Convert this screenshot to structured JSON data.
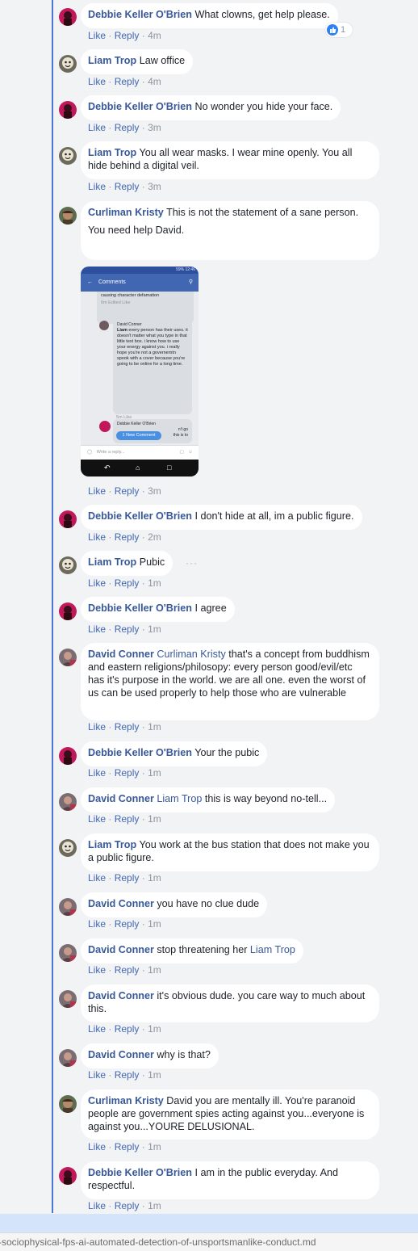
{
  "comments": [
    {
      "author": "Debbie Keller O'Brien",
      "text": "What clowns, get help please.",
      "like": "Like",
      "reply": "Reply",
      "time": "4m",
      "reactions": "1"
    },
    {
      "author": "Liam Trop",
      "text": "Law office",
      "like": "Like",
      "reply": "Reply",
      "time": "4m"
    },
    {
      "author": "Debbie Keller O'Brien",
      "text": "No wonder you hide your face.",
      "like": "Like",
      "reply": "Reply",
      "time": "3m"
    },
    {
      "author": "Liam Trop",
      "text": "You all wear masks. I wear mine openly. You all hide behind a digital veil.",
      "like": "Like",
      "reply": "Reply",
      "time": "3m"
    },
    {
      "author": "Curliman Kristy",
      "text": "This is not the statement of a sane person.",
      "text2": "You need help David.",
      "like": "Like",
      "reply": "Reply",
      "time": "3m"
    },
    {
      "author": "Debbie Keller O'Brien",
      "text": "I don't hide at all, im a public figure.",
      "like": "Like",
      "reply": "Reply",
      "time": "2m"
    },
    {
      "author": "Liam Trop",
      "text": "Pubic",
      "like": "Like",
      "reply": "Reply",
      "time": "1m"
    },
    {
      "author": "Debbie Keller O'Brien",
      "text": "I agree",
      "like": "Like",
      "reply": "Reply",
      "time": "1m"
    },
    {
      "author": "David Conner",
      "mention": "Curliman Kristy",
      "text": "that's a concept from buddhism and eastern religions/philosopy: every person good/evil/etc has it's purpose in the world. we are all one. even the worst of us can be used properly to help those who are vulnerable",
      "like": "Like",
      "reply": "Reply",
      "time": "1m"
    },
    {
      "author": "Debbie Keller O'Brien",
      "text": "Your the pubic",
      "like": "Like",
      "reply": "Reply",
      "time": "1m"
    },
    {
      "author": "David Conner",
      "mention": "Liam Trop",
      "text": "this is way beyond no-tell...",
      "like": "Like",
      "reply": "Reply",
      "time": "1m"
    },
    {
      "author": "Liam Trop",
      "text": "You work at the bus station that does not make you a public figure.",
      "like": "Like",
      "reply": "Reply",
      "time": "1m"
    },
    {
      "author": "David Conner",
      "text": "you have no clue dude",
      "like": "Like",
      "reply": "Reply",
      "time": "1m"
    },
    {
      "author": "David Conner",
      "text": "stop threatening her",
      "mention_after": "Liam Trop",
      "like": "Like",
      "reply": "Reply",
      "time": "1m"
    },
    {
      "author": "David Conner",
      "text": "it's obvious dude. you care way to much about this.",
      "like": "Like",
      "reply": "Reply",
      "time": "1m"
    },
    {
      "author": "David Conner",
      "text": "why is that?",
      "like": "Like",
      "reply": "Reply",
      "time": "1m"
    },
    {
      "author": "Curliman Kristy",
      "text": "David you are mentally ill. You're paranoid people are government spies acting against you...everyone is against you...YOURE DELUSIONAL.",
      "like": "Like",
      "reply": "Reply",
      "time": "1m"
    },
    {
      "author": "Debbie Keller O'Brien",
      "text": "I am in the public everyday. And respectful.",
      "like": "Like",
      "reply": "Reply",
      "time": "1m"
    }
  ],
  "screenshot": {
    "status": "59% 12:46",
    "header": "Comments",
    "item1_text": "causing character defamation",
    "item1_meta": "6m   Edited   Like",
    "item2_author": "David Conner",
    "item2_name": "Liam",
    "item2_text": "every person has their uses. it doesn't matter what you type in that little text box. i know how to use your energy against you. i really hope you're not a governemtn spook with a cover because you're going to be online for a long time.",
    "item2_meta": "5m    Like",
    "item3_author": "Debbie Keller O'Brien",
    "item3_text": "n't go",
    "item3_text2": "this is to",
    "new_comment": "1 New Comment",
    "input_placeholder": "Write a reply..."
  },
  "separator": "·",
  "menu_dots": "···",
  "pathbar": {
    "text": "-sociophysical-fps-ai-automated-detection-of-unsportsmanlike-conduct.md"
  },
  "colors": {
    "link": "#385898",
    "action": "#4267b2",
    "muted": "#8d949e",
    "thread": "#4a76d6"
  }
}
